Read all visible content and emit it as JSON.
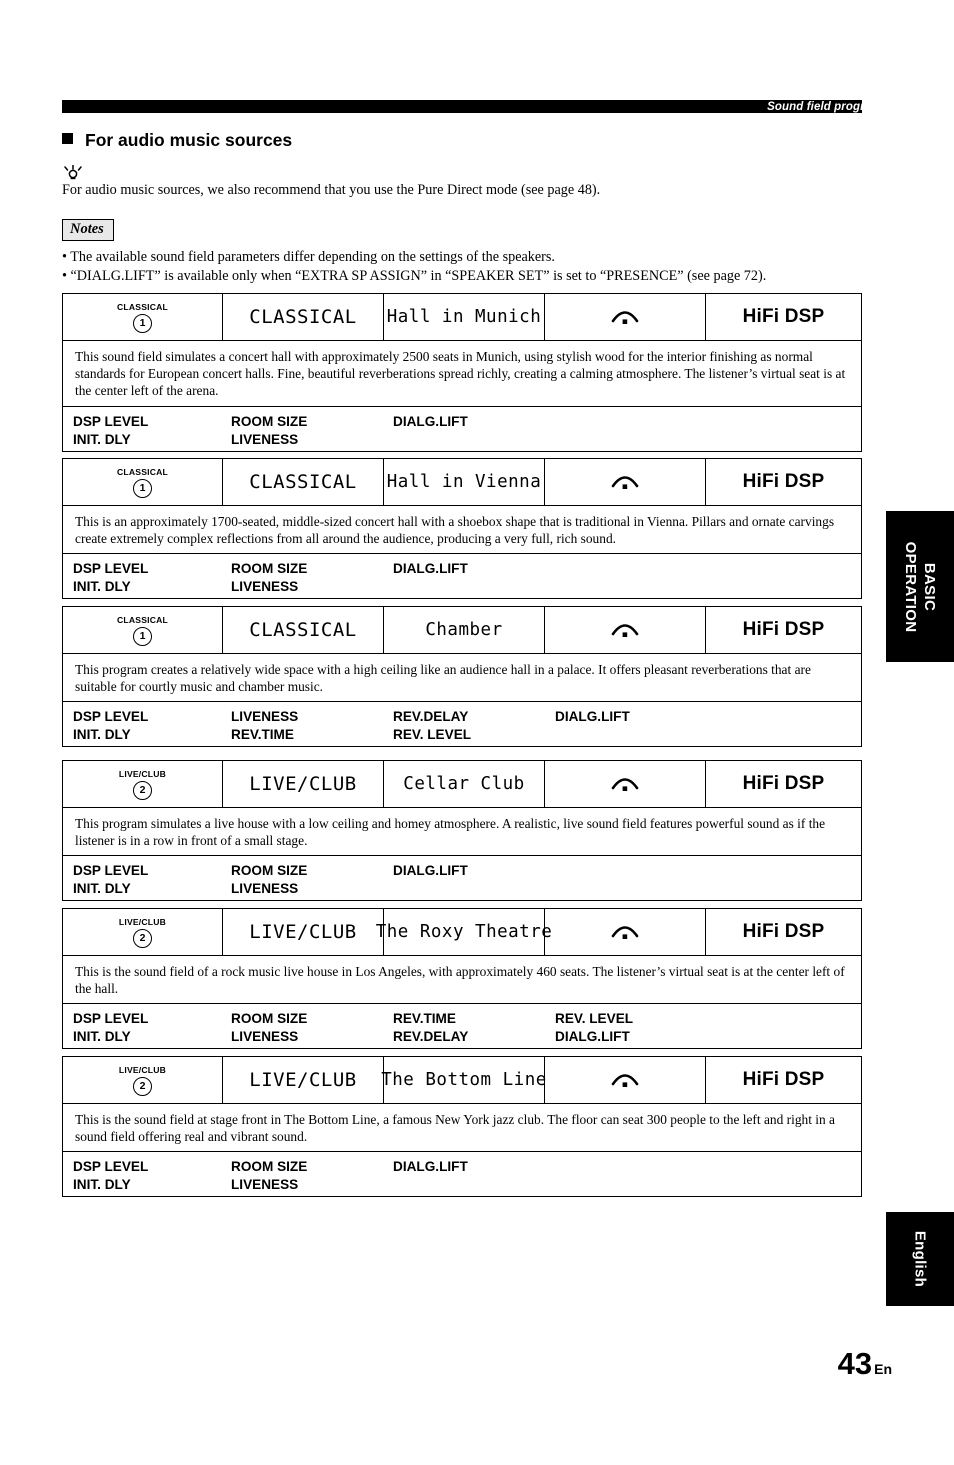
{
  "header": {
    "running_head": "Sound field programs"
  },
  "section": {
    "title": "For audio music sources",
    "tip_icon": "tip-bulb-icon",
    "tip_text": "For audio music sources, we also recommend that you use the Pure Direct mode (see page 48).",
    "notes_label": "Notes",
    "notes": [
      "• The available sound field parameters differ depending on the settings of the speakers.",
      "• “DIALG.LIFT” is available only when “EXTRA SP ASSIGN” in “SPEAKER SET” is set to “PRESENCE” (see page 72)."
    ]
  },
  "programs": [
    {
      "category": "CLASSICAL",
      "number": "1",
      "display_name": "CLASSICAL",
      "display_title": "Hall in Munich",
      "indicator_icon": "presence-speaker-icon",
      "dsp_label": "HiFi DSP",
      "description": "This sound field simulates a concert hall with approximately 2500 seats in Munich, using stylish wood for the interior finishing as normal standards for European concert halls. Fine, beautiful reverberations spread richly, creating a calming atmosphere. The listener’s virtual seat is at the center left of the arena.",
      "params": [
        [
          "DSP LEVEL",
          "ROOM SIZE",
          "DIALG.LIFT",
          ""
        ],
        [
          "INIT. DLY",
          "LIVENESS",
          "",
          ""
        ]
      ]
    },
    {
      "category": "CLASSICAL",
      "number": "1",
      "display_name": "CLASSICAL",
      "display_title": "Hall in Vienna",
      "indicator_icon": "presence-speaker-icon",
      "dsp_label": "HiFi DSP",
      "description": "This is an approximately 1700-seated, middle-sized concert hall with a shoebox shape that is traditional in Vienna. Pillars and ornate carvings create extremely complex reflections from all around the audience, producing a very full, rich sound.",
      "params": [
        [
          "DSP LEVEL",
          "ROOM SIZE",
          "DIALG.LIFT",
          ""
        ],
        [
          "INIT. DLY",
          "LIVENESS",
          "",
          ""
        ]
      ]
    },
    {
      "category": "CLASSICAL",
      "number": "1",
      "display_name": "CLASSICAL",
      "display_title": "Chamber",
      "indicator_icon": "presence-speaker-icon",
      "dsp_label": "HiFi DSP",
      "description": "This program creates a relatively wide space with a high ceiling like an audience hall in a palace. It offers pleasant reverberations that are suitable for courtly music and chamber music.",
      "params": [
        [
          "DSP LEVEL",
          "LIVENESS",
          "REV.DELAY",
          "DIALG.LIFT"
        ],
        [
          "INIT. DLY",
          "REV.TIME",
          "REV. LEVEL",
          ""
        ]
      ]
    },
    {
      "category": "LIVE/CLUB",
      "number": "2",
      "display_name": "LIVE/CLUB",
      "display_title": "Cellar Club",
      "indicator_icon": "presence-speaker-icon",
      "dsp_label": "HiFi DSP",
      "description": "This program simulates a live house with a low ceiling and homey atmosphere. A realistic, live sound field features powerful sound as if the listener is in a row in front of a small stage.",
      "params": [
        [
          "DSP LEVEL",
          "ROOM SIZE",
          "DIALG.LIFT",
          ""
        ],
        [
          "INIT. DLY",
          "LIVENESS",
          "",
          ""
        ]
      ]
    },
    {
      "category": "LIVE/CLUB",
      "number": "2",
      "display_name": "LIVE/CLUB",
      "display_title": "The Roxy Theatre",
      "indicator_icon": "presence-speaker-icon",
      "dsp_label": "HiFi DSP",
      "description": "This is the sound field of a rock music live house in Los Angeles, with approximately 460 seats. The listener’s virtual seat is at the center left of the hall.",
      "params": [
        [
          "DSP LEVEL",
          "ROOM SIZE",
          "REV.TIME",
          "REV. LEVEL"
        ],
        [
          "INIT. DLY",
          "LIVENESS",
          "REV.DELAY",
          "DIALG.LIFT"
        ]
      ]
    },
    {
      "category": "LIVE/CLUB",
      "number": "2",
      "display_name": "LIVE/CLUB",
      "display_title": "The Bottom Line",
      "indicator_icon": "presence-speaker-icon",
      "dsp_label": "HiFi DSP",
      "description": "This is the sound field at stage front in The Bottom Line, a famous New York jazz club. The floor can seat 300 people to the left and right in a sound field offering real and vibrant sound.",
      "params": [
        [
          "DSP LEVEL",
          "ROOM SIZE",
          "DIALG.LIFT",
          ""
        ],
        [
          "INIT. DLY",
          "LIVENESS",
          "",
          ""
        ]
      ]
    }
  ],
  "side_tabs": {
    "basic_operation": "BASIC\nOPERATION",
    "basic_line1": "BASIC",
    "basic_line2": "OPERATION",
    "language": "English"
  },
  "footer": {
    "page_number": "43",
    "page_suffix": "En"
  }
}
